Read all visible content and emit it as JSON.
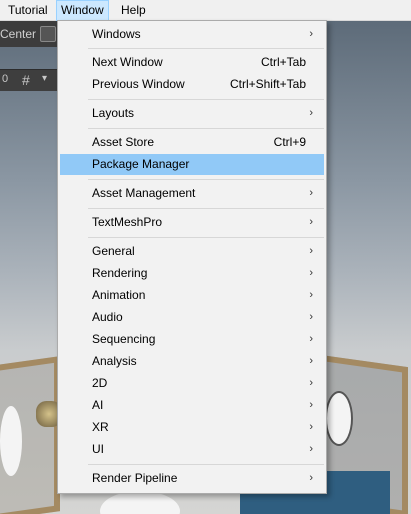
{
  "menubar": {
    "items": [
      "Tutorial",
      "Window",
      "Help"
    ]
  },
  "scene": {
    "toolbar_text": "Center",
    "zero_label": "0"
  },
  "menu": {
    "windows": "Windows",
    "next_window": {
      "label": "Next Window",
      "shortcut": "Ctrl+Tab"
    },
    "previous_window": {
      "label": "Previous Window",
      "shortcut": "Ctrl+Shift+Tab"
    },
    "layouts": "Layouts",
    "asset_store": {
      "label": "Asset Store",
      "shortcut": "Ctrl+9"
    },
    "package_manager": "Package Manager",
    "asset_management": "Asset Management",
    "textmeshpro": "TextMeshPro",
    "general": "General",
    "rendering": "Rendering",
    "animation": "Animation",
    "audio": "Audio",
    "sequencing": "Sequencing",
    "analysis": "Analysis",
    "twod": "2D",
    "ai": "AI",
    "xr": "XR",
    "ui": "UI",
    "render_pipeline": "Render Pipeline",
    "submenu_arrow": "›"
  },
  "colors": {
    "highlight": "#91c9f7",
    "menubar_active": "#cce8ff"
  }
}
